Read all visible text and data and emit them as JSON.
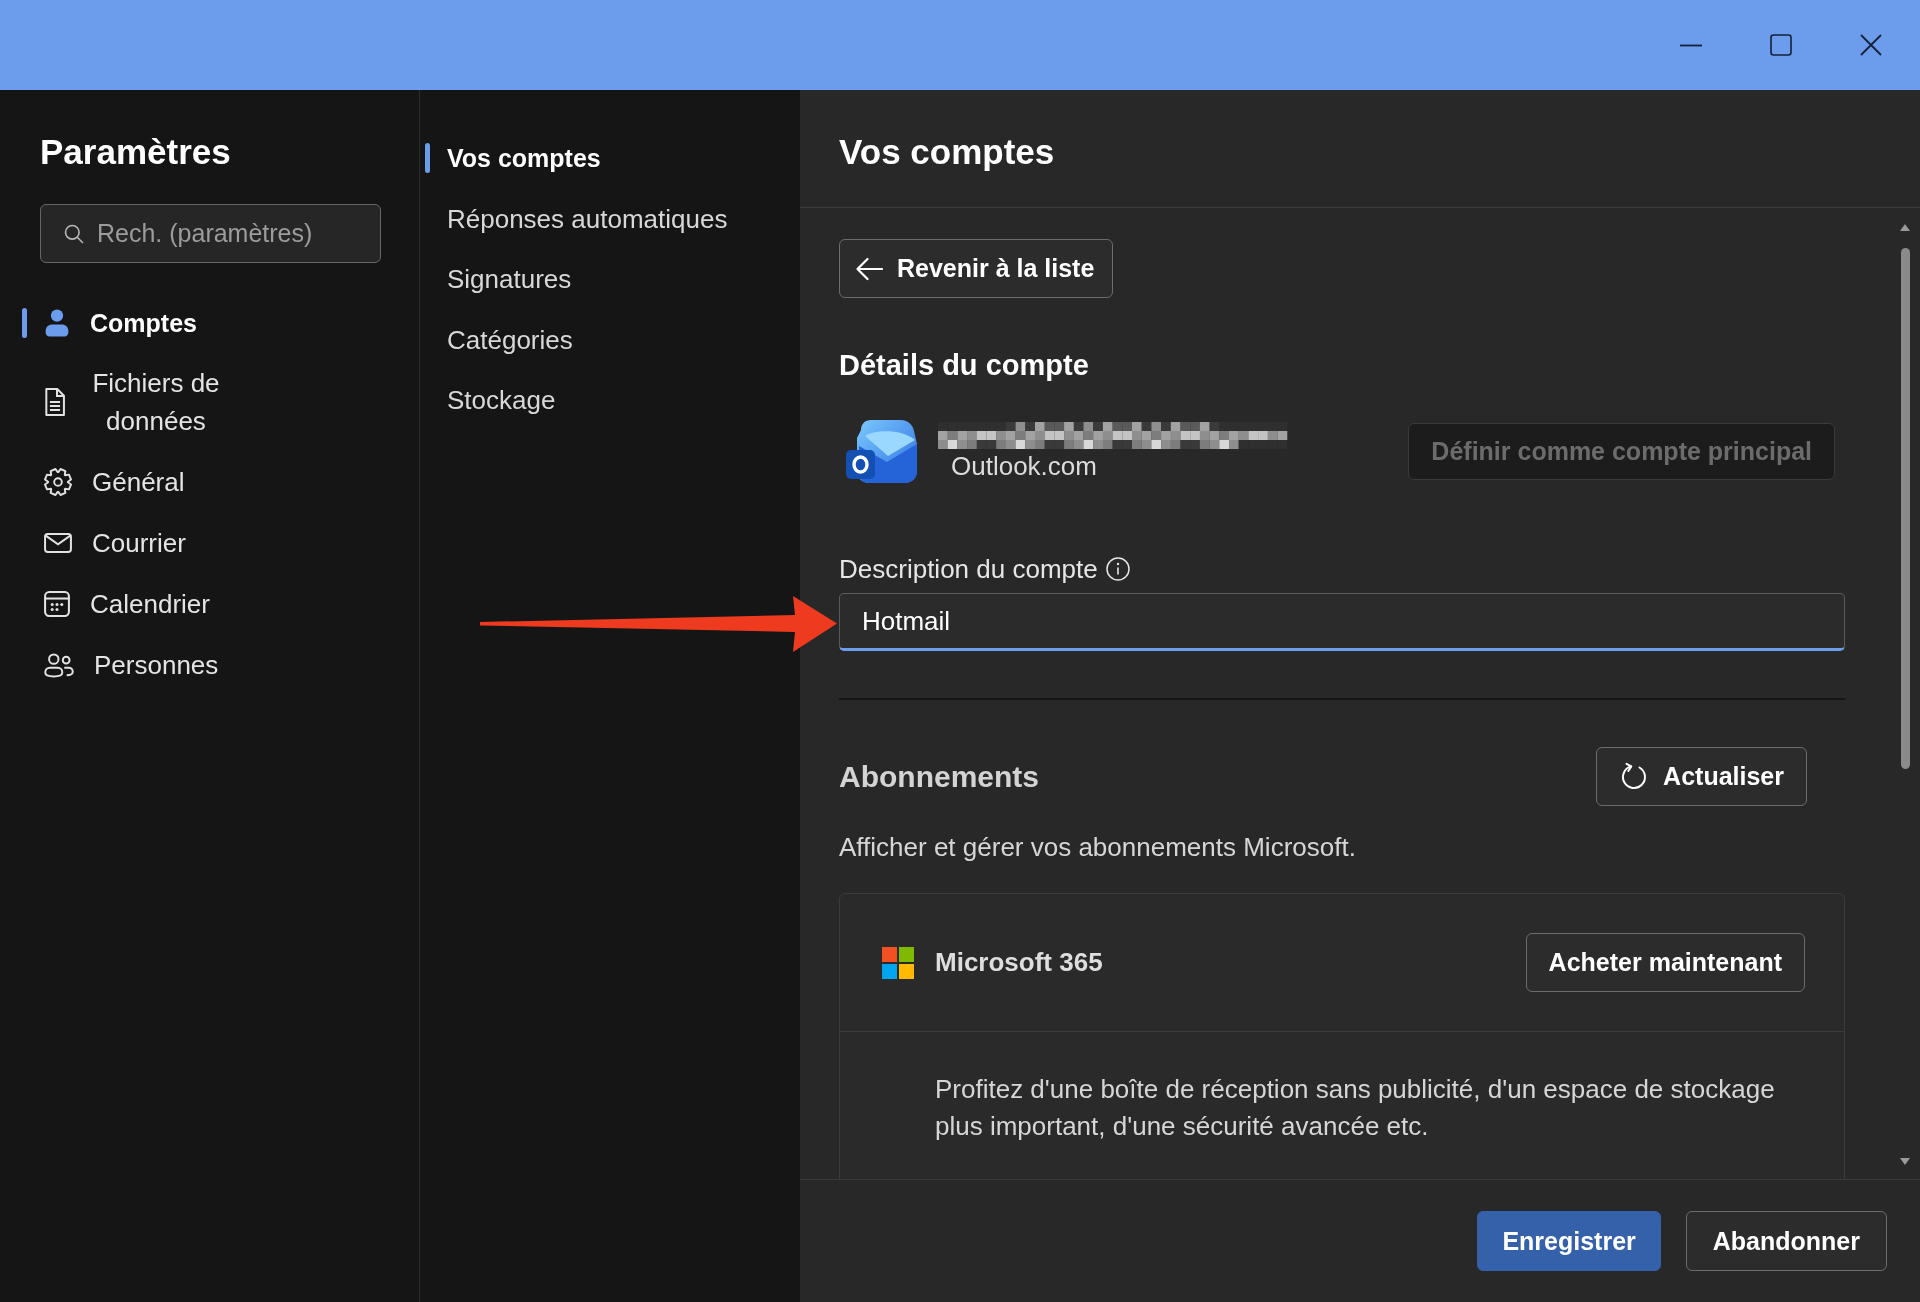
{
  "sidebar": {
    "title": "Paramètres",
    "search": {
      "placeholder": "Rech. (paramètres)"
    },
    "items": [
      {
        "label": "Comptes",
        "kind": "accounts",
        "selected": true
      },
      {
        "label": "Fichiers de données",
        "kind": "files",
        "selected": false
      },
      {
        "label": "Général",
        "kind": "general",
        "selected": false
      },
      {
        "label": "Courrier",
        "kind": "mail",
        "selected": false
      },
      {
        "label": "Calendrier",
        "kind": "calendar",
        "selected": false
      },
      {
        "label": "Personnes",
        "kind": "people",
        "selected": false
      }
    ]
  },
  "subnav": {
    "items": [
      {
        "label": "Vos comptes",
        "selected": true
      },
      {
        "label": "Réponses automatiques",
        "selected": false
      },
      {
        "label": "Signatures",
        "selected": false
      },
      {
        "label": "Catégories",
        "selected": false
      },
      {
        "label": "Stockage",
        "selected": false
      }
    ]
  },
  "content": {
    "title": "Vos comptes",
    "back_button": "Revenir à la liste",
    "account_details": {
      "heading": "Détails du compte",
      "email_redacted": true,
      "provider": "Outlook.com",
      "set_primary_button": {
        "label": "Définir comme compte principal",
        "disabled": true
      },
      "description": {
        "label": "Description du compte",
        "value": "Hotmail",
        "focused": true
      }
    },
    "subscriptions": {
      "heading": "Abonnements",
      "refresh_button": "Actualiser",
      "description": "Afficher et gérer vos abonnements Microsoft.",
      "products": [
        {
          "name": "Microsoft 365",
          "button": "Acheter maintenant",
          "details": "Profitez d'une boîte de réception sans publicité, d'un espace de stockage plus important, d'une sécurité avancée etc."
        }
      ]
    }
  },
  "footer": {
    "buttons": [
      {
        "label": "Enregistrer",
        "kind": "primary"
      },
      {
        "label": "Abandonner",
        "kind": "secondary"
      }
    ]
  },
  "annotations": [
    {
      "kind": "arrow"
    }
  ]
}
